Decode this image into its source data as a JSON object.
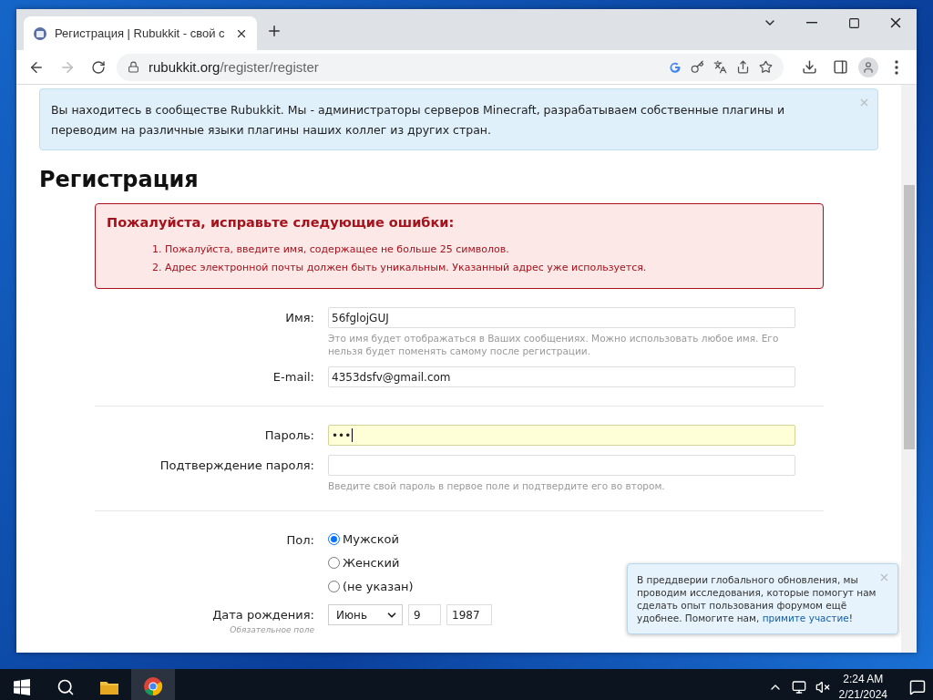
{
  "browser": {
    "tab": {
      "title": "Регистрация | Rubukkit - свой с",
      "selected": true
    },
    "url": {
      "host": "rubukkit.org",
      "path": "/register/register"
    }
  },
  "info_banner": {
    "text": "Вы находитесь в сообществе Rubukkit. Мы - администраторы серверов Minecraft, разрабатываем собственные плагины и переводим на различные языки плагины наших коллег из других стран."
  },
  "heading": "Регистрация",
  "errors": {
    "title": "Пожалуйста, исправьте следующие ошибки:",
    "items": [
      "1. Пожалуйста, введите имя, содержащее не больше 25 символов.",
      "2. Адрес электронной почты должен быть уникальным. Указанный адрес уже используется."
    ]
  },
  "form_groups": [
    {
      "fields": [
        {
          "label": "Имя:",
          "value": "56fglojGUJ",
          "focused": false,
          "hint": "Это имя будет отображаться в Ваших сообщениях. Можно использовать любое имя. Его нельзя будет поменять самому после регистрации."
        },
        {
          "label": "E-mail:",
          "value": "4353dsfv@gmail.com",
          "focused": false
        }
      ]
    },
    {
      "fields": [
        {
          "label": "Пароль:",
          "value": "•••",
          "focused": true
        },
        {
          "label": "Подтверждение пароля:",
          "focused": false,
          "hint": "Введите свой пароль в первое поле и подтвердите его во втором."
        }
      ]
    }
  ],
  "gender": {
    "label": "Пол:",
    "options": [
      {
        "label": "Мужской",
        "selected": true
      },
      {
        "label": "Женский",
        "selected": false
      },
      {
        "label": "(не указан)",
        "selected": false
      }
    ]
  },
  "birthdate": {
    "label": "Дата рождения:",
    "note": "Обязательное поле",
    "month": "Июнь",
    "day": "9",
    "year": "1987"
  },
  "popup": {
    "text": "В преддверии глобального обновления, мы проводим исследования, которые помогут нам сделать опыт пользования форумом ещё удобнее. Помогите нам, ",
    "link": "примите участие",
    "after": "!"
  },
  "taskbar": {
    "time": "2:24 AM",
    "date": "2/21/2024"
  }
}
